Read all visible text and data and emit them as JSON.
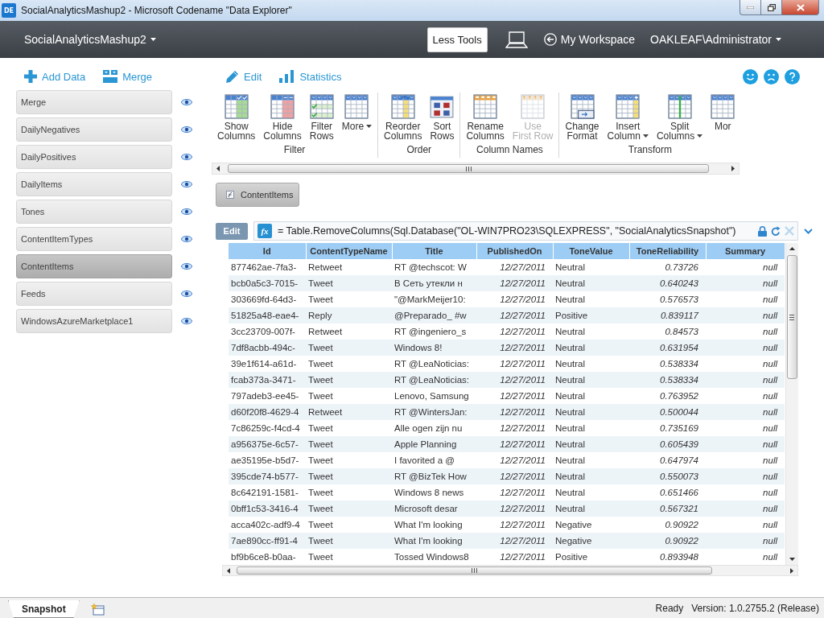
{
  "window": {
    "logo": "DE",
    "title": "SocialAnalyticsMashup2 - Microsoft Codename \"Data Explorer\""
  },
  "header": {
    "workbook": "SocialAnalyticsMashup2",
    "less_tools": "Less Tools",
    "workspace": "My Workspace",
    "user": "OAKLEAF\\Administrator"
  },
  "sidebar": {
    "actions": [
      {
        "kind": "add",
        "label": "Add Data"
      },
      {
        "kind": "merge",
        "label": "Merge"
      }
    ],
    "items": [
      {
        "label": "Merge",
        "selected": false
      },
      {
        "label": "DailyNegatives",
        "selected": false
      },
      {
        "label": "DailyPositives",
        "selected": false
      },
      {
        "label": "DailyItems",
        "selected": false
      },
      {
        "label": "Tones",
        "selected": false
      },
      {
        "label": "ContentItemTypes",
        "selected": false
      },
      {
        "label": "ContentItems",
        "selected": true
      },
      {
        "label": "Feeds",
        "selected": false
      },
      {
        "label": "WindowsAzureMarketplace1",
        "selected": false
      }
    ]
  },
  "modes": [
    {
      "kind": "edit",
      "label": "Edit"
    },
    {
      "kind": "statistics",
      "label": "Statistics"
    }
  ],
  "ribbon": {
    "groups": [
      {
        "label": "Filter",
        "buttons": [
          {
            "kind": "show-columns",
            "lines": [
              "Show",
              "Columns"
            ],
            "dropdown": false,
            "disabled": false
          },
          {
            "kind": "hide-columns",
            "lines": [
              "Hide",
              "Columns"
            ],
            "dropdown": false,
            "disabled": false
          },
          {
            "kind": "filter-rows",
            "lines": [
              "Filter",
              "Rows"
            ],
            "dropdown": false,
            "disabled": false
          },
          {
            "kind": "more",
            "lines": [
              "More"
            ],
            "dropdown": true,
            "disabled": false
          }
        ]
      },
      {
        "label": "Order",
        "buttons": [
          {
            "kind": "reorder-columns",
            "lines": [
              "Reorder",
              "Columns"
            ],
            "dropdown": false,
            "disabled": false
          },
          {
            "kind": "sort-rows",
            "lines": [
              "Sort",
              "Rows"
            ],
            "dropdown": false,
            "disabled": false
          }
        ]
      },
      {
        "label": "Column Names",
        "buttons": [
          {
            "kind": "rename-columns",
            "lines": [
              "Rename",
              "Columns"
            ],
            "dropdown": false,
            "disabled": false
          },
          {
            "kind": "use-first-row",
            "lines": [
              "Use",
              "First Row"
            ],
            "dropdown": false,
            "disabled": true
          }
        ]
      },
      {
        "label": "Transform",
        "buttons": [
          {
            "kind": "change-format",
            "lines": [
              "Change",
              "Format"
            ],
            "dropdown": false,
            "disabled": false
          },
          {
            "kind": "insert-column",
            "lines": [
              "Insert",
              "Column"
            ],
            "dropdown": true,
            "disabled": false
          },
          {
            "kind": "split-columns",
            "lines": [
              "Split",
              "Columns"
            ],
            "dropdown": true,
            "disabled": false
          },
          {
            "kind": "more",
            "lines": [
              "Mor"
            ],
            "dropdown": false,
            "disabled": false
          }
        ]
      }
    ]
  },
  "source": {
    "label": "ContentItems"
  },
  "formula": {
    "edit": {
      "label": "Edit",
      "disabled": true
    },
    "badge": "fx",
    "text": "= Table.RemoveColumns(Sql.Database(\"OL-WIN7PRO23\\SQLEXPRESS\", \"SocialAnalyticsSnapshot\")"
  },
  "table": {
    "columns": [
      {
        "label": "Id",
        "kind": "text"
      },
      {
        "label": "ContentTypeName",
        "kind": "text"
      },
      {
        "label": "Title",
        "kind": "text"
      },
      {
        "label": "PublishedOn",
        "kind": "date"
      },
      {
        "label": "ToneValue",
        "kind": "text"
      },
      {
        "label": "ToneReliability",
        "kind": "number"
      },
      {
        "label": "Summary",
        "kind": "null"
      }
    ],
    "rows": [
      [
        "877462ae-7fa3-",
        "Retweet",
        "RT @techscot: W",
        "12/27/2011",
        "Neutral",
        "0.73726",
        "null"
      ],
      [
        "bcb0a5c3-7015-",
        "Tweet",
        "В Сеть утекли н",
        "12/27/2011",
        "Neutral",
        "0.640243",
        "null"
      ],
      [
        "303669fd-64d3-",
        "Tweet",
        "\"@MarkMeijer10:",
        "12/27/2011",
        "Neutral",
        "0.576573",
        "null"
      ],
      [
        "51825a48-eae4-",
        "Reply",
        "@Preparado_ #w",
        "12/27/2011",
        "Positive",
        "0.839117",
        "null"
      ],
      [
        "3cc23709-007f-",
        "Retweet",
        "RT @ingeniero_s",
        "12/27/2011",
        "Neutral",
        "0.84573",
        "null"
      ],
      [
        "7df8acbb-494c-",
        "Tweet",
        "Windows 8!",
        "12/27/2011",
        "Neutral",
        "0.631954",
        "null"
      ],
      [
        "39e1f614-a61d-",
        "Tweet",
        "RT @LeaNoticias:",
        "12/27/2011",
        "Neutral",
        "0.538334",
        "null"
      ],
      [
        "fcab373a-3471-",
        "Tweet",
        "RT @LeaNoticias:",
        "12/27/2011",
        "Neutral",
        "0.538334",
        "null"
      ],
      [
        "797adeb3-ee45-",
        "Tweet",
        "Lenovo, Samsung",
        "12/27/2011",
        "Neutral",
        "0.763952",
        "null"
      ],
      [
        "d60f20f8-4629-4",
        "Retweet",
        "RT @WintersJan:",
        "12/27/2011",
        "Neutral",
        "0.500044",
        "null"
      ],
      [
        "7c86259c-f4cd-4",
        "Tweet",
        "Alle ogen zijn nu",
        "12/27/2011",
        "Neutral",
        "0.735169",
        "null"
      ],
      [
        "a956375e-6c57-",
        "Tweet",
        "Apple Planning",
        "12/27/2011",
        "Neutral",
        "0.605439",
        "null"
      ],
      [
        "ae35195e-b5d7-",
        "Tweet",
        "I favorited a @",
        "12/27/2011",
        "Neutral",
        "0.647974",
        "null"
      ],
      [
        "395cde74-b577-",
        "Tweet",
        "RT @BizTek How",
        "12/27/2011",
        "Neutral",
        "0.550073",
        "null"
      ],
      [
        "8c642191-1581-",
        "Tweet",
        "Windows 8 news",
        "12/27/2011",
        "Neutral",
        "0.651466",
        "null"
      ],
      [
        "0bff1c53-3416-4",
        "Tweet",
        "Microsoft desar",
        "12/27/2011",
        "Neutral",
        "0.567321",
        "null"
      ],
      [
        "acca402c-adf9-4",
        "Tweet",
        "What I'm looking",
        "12/27/2011",
        "Negative",
        "0.90922",
        "null"
      ],
      [
        "7ae890cc-ff91-4",
        "Tweet",
        "What I'm looking",
        "12/27/2011",
        "Negative",
        "0.90922",
        "null"
      ],
      [
        "bf9b6ce8-b0aa-",
        "Tweet",
        "Tossed Windows8",
        "12/27/2011",
        "Positive",
        "0.893948",
        "null"
      ]
    ]
  },
  "status_bar": {
    "tabs": [
      {
        "label": "Snapshot",
        "selected": true
      }
    ],
    "status": "Ready",
    "version": "Version: 1.0.2755.2 (Release)"
  }
}
